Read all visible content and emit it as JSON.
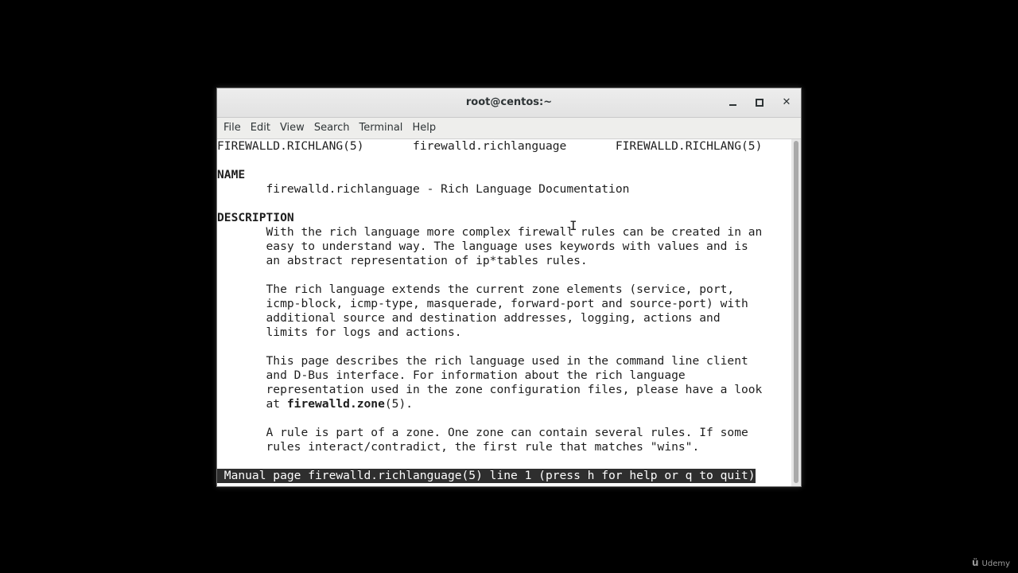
{
  "window": {
    "title": "root@centos:~"
  },
  "menu": [
    "File",
    "Edit",
    "View",
    "Search",
    "Terminal",
    "Help"
  ],
  "terminal": {
    "header_left": "FIREWALLD.RICHLANG(5)",
    "header_center": "firewalld.richlanguage",
    "header_right": "FIREWALLD.RICHLANG(5)",
    "name_heading": "NAME",
    "name_line": "firewalld.richlanguage - Rich Language Documentation",
    "description_heading": "DESCRIPTION",
    "p1": [
      "With the rich language more complex firewall rules can be created in an",
      "easy to understand way. The language uses keywords with values and is",
      "an abstract representation of ip*tables rules."
    ],
    "p2": [
      "The rich language extends the current zone elements (service, port,",
      "icmp-block, icmp-type, masquerade, forward-port and source-port) with",
      "additional source and destination addresses, logging, actions and",
      "limits for logs and actions."
    ],
    "p3": [
      "This page describes the rich language used in the command line client",
      "and D-Bus interface. For information about the rich language",
      "representation used in the zone configuration files, please have a look"
    ],
    "p3_last_prefix": "at ",
    "p3_last_bold": "firewalld.zone",
    "p3_last_suffix": "(5).",
    "p4": [
      "A rule is part of a zone. One zone can contain several rules. If some",
      "rules interact/contradict, the first rule that matches \"wins\"."
    ],
    "status_line": " Manual page firewalld.richlanguage(5) line 1 (press h for help or q to quit)"
  },
  "icons": {
    "minimize": "minimize-icon",
    "maximize": "maximize-icon",
    "close": "close-icon",
    "cursor": "text-cursor-icon"
  },
  "watermark": "Udemy"
}
